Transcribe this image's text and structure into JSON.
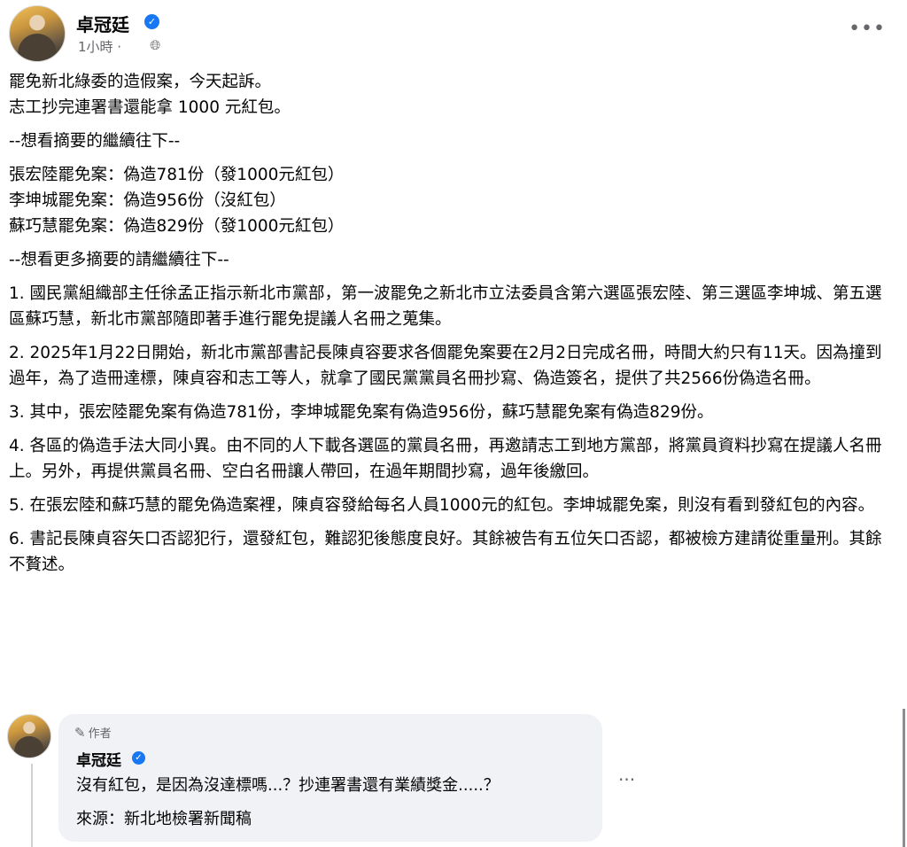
{
  "post": {
    "author": "卓冠廷",
    "time": "1小時 ·",
    "paragraphs_top": [
      "罷免新北綠委的造假案，今天起訴。",
      "志工抄完連署書還能拿 1000 元紅包。"
    ],
    "divider1": "--想看摘要的繼續往下--",
    "summary": [
      "張宏陸罷免案：偽造781份（發1000元紅包）",
      "李坤城罷免案：偽造956份（沒紅包）",
      "蘇巧慧罷免案：偽造829份（發1000元紅包）"
    ],
    "divider2": "--想看更多摘要的請繼續往下--",
    "points": [
      "1. 國民黨組織部主任徐孟正指示新北市黨部，第一波罷免之新北市立法委員含第六選區張宏陸、第三選區李坤城、第五選區蘇巧慧，新北市黨部隨即著手進行罷免提議人名冊之蒐集。",
      "2. 2025年1月22日開始，新北市黨部書記長陳貞容要求各個罷免案要在2月2日完成名冊，時間大約只有11天。因為撞到過年，為了造冊達標，陳貞容和志工等人，就拿了國民黨黨員名冊抄寫、偽造簽名，提供了共2566份偽造名冊。",
      "3. 其中，張宏陸罷免案有偽造781份，李坤城罷免案有偽造956份，蘇巧慧罷免案有偽造829份。",
      "4. 各區的偽造手法大同小異。由不同的人下載各選區的黨員名冊，再邀請志工到地方黨部，將黨員資料抄寫在提議人名冊上。另外，再提供黨員名冊、空白名冊讓人帶回，在過年期間抄寫，過年後繳回。",
      "5. 在張宏陸和蘇巧慧的罷免偽造案裡，陳貞容發給每名人員1000元的紅包。李坤城罷免案，則沒有看到發紅包的內容。",
      "6. 書記長陳貞容矢口否認犯行，還發紅包，難認犯後態度良好。其餘被告有五位矢口否認，都被檢方建請從重量刑。其餘不贅述。"
    ]
  },
  "comment": {
    "badge": "作者",
    "author": "卓冠廷",
    "line1": "沒有紅包，是因為沒達標嗎...？抄連署書還有業績獎金.....？",
    "line2": "來源：新北地檢署新聞稿"
  },
  "icons": {
    "verified": "verified-badge-icon",
    "globe": "globe-icon",
    "more": "more-options-icon",
    "pen": "pen-icon"
  },
  "colors": {
    "verified": "#1877f2",
    "bubble": "#f0f2f5",
    "secondary_text": "#65676b"
  }
}
